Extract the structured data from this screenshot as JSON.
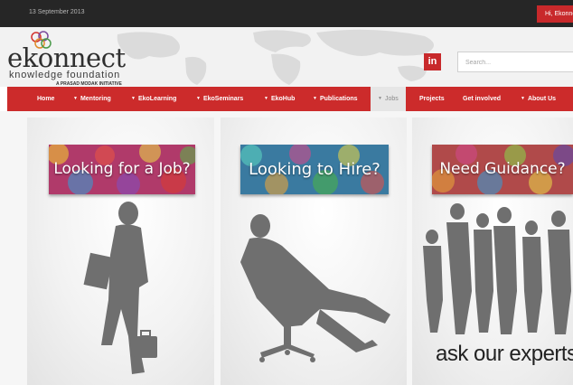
{
  "topbar": {
    "date": "13 September 2013",
    "greeting": "Hi, Ekonnect"
  },
  "logo": {
    "name": "ekonnect",
    "subtitle": "knowledge foundation",
    "tagline": "A PRASAD MODAK INITIATIVE"
  },
  "social": {
    "linkedin_label": "in"
  },
  "search": {
    "placeholder": "Search..."
  },
  "nav": {
    "items": [
      {
        "label": "Home",
        "dropdown": false
      },
      {
        "label": "Mentoring",
        "dropdown": true
      },
      {
        "label": "EkoLearning",
        "dropdown": true
      },
      {
        "label": "EkoSeminars",
        "dropdown": true
      },
      {
        "label": "EkoHub",
        "dropdown": true
      },
      {
        "label": "Publications",
        "dropdown": true
      },
      {
        "label": "Jobs",
        "dropdown": true,
        "active": true
      },
      {
        "label": "Projects",
        "dropdown": false
      },
      {
        "label": "Get involved",
        "dropdown": false
      },
      {
        "label": "About Us",
        "dropdown": true
      }
    ],
    "dropdown_glyph": "▼"
  },
  "panels": [
    {
      "banner": "Looking for a Job?"
    },
    {
      "banner": "Looking to Hire?"
    },
    {
      "banner": "Need Guidance?",
      "caption": "ask our experts."
    }
  ],
  "colors": {
    "brand_red": "#cc2b2b",
    "topbar": "#262626",
    "silhouette": "#6f6f6f"
  }
}
